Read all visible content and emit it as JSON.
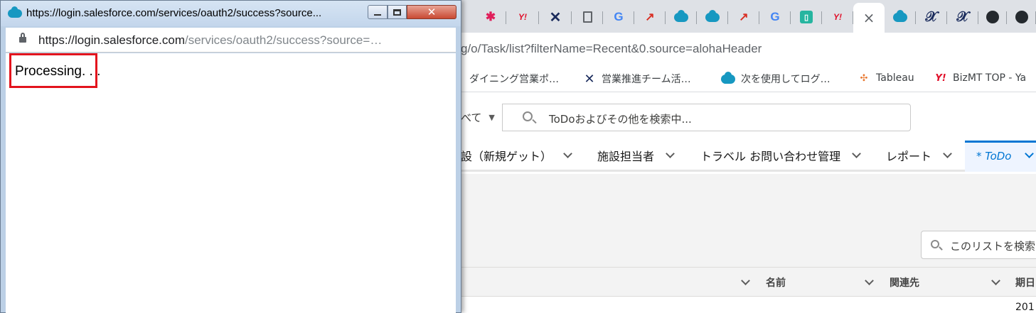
{
  "background_browser": {
    "tabs": [
      {
        "icon": "slack-icon"
      },
      {
        "icon": "yahoo-icon",
        "glyph": "Y!"
      },
      {
        "icon": "x-logo-icon",
        "glyph": "✕"
      },
      {
        "icon": "document-icon"
      },
      {
        "icon": "google-icon",
        "glyph": "G"
      },
      {
        "icon": "red-arrow-icon",
        "glyph": "↗"
      },
      {
        "icon": "salesforce-cloud-icon"
      },
      {
        "icon": "salesforce-cloud-icon"
      },
      {
        "icon": "red-arrow-icon",
        "glyph": "↗"
      },
      {
        "icon": "google-icon",
        "glyph": "G"
      },
      {
        "icon": "green-app-icon",
        "glyph": "▯"
      },
      {
        "icon": "yahoo-icon",
        "glyph": "Y!"
      },
      {
        "icon": "close-tab-icon",
        "glyph": "×",
        "active": true
      },
      {
        "icon": "salesforce-cloud-icon"
      },
      {
        "icon": "x-logo-icon",
        "glyph": "𝒳"
      },
      {
        "icon": "x-logo-icon",
        "glyph": "𝒳"
      },
      {
        "icon": "github-icon"
      },
      {
        "icon": "github-icon"
      }
    ],
    "address": "g/o/Task/list?filterName=Recent&0.source=alohaHeader",
    "bookmarks": [
      {
        "label": "ダイニング営業ポ…",
        "icon": "none"
      },
      {
        "label": "営業推進チーム活…",
        "icon": "x-logo-icon"
      },
      {
        "label": "次を使用してログ…",
        "icon": "salesforce-cloud-icon"
      },
      {
        "label": "Tableau",
        "icon": "tableau-icon"
      },
      {
        "label": "BizMT TOP - Ya",
        "icon": "yahoo-icon"
      }
    ],
    "search": {
      "scope_label": "べて",
      "placeholder": "ToDoおよびその他を検索中..."
    },
    "nav": {
      "items": [
        {
          "label": "設（新規ゲット）"
        },
        {
          "label": "施設担当者"
        },
        {
          "label": "トラベル お問い合わせ管理"
        },
        {
          "label": "レポート"
        }
      ],
      "active_tab": "* ToDo"
    },
    "list_search_placeholder": "このリストを検索",
    "table": {
      "columns": [
        "名前",
        "関連先",
        "期日"
      ],
      "first_row_date": "201"
    }
  },
  "popup": {
    "title": "https://login.salesforce.com/services/oauth2/success?source...",
    "url_host": "https://login.salesforce.com",
    "url_path": "/services/oauth2/success?source=…",
    "body_text": "Processing. . .",
    "highlight_color": "#e3141d"
  }
}
